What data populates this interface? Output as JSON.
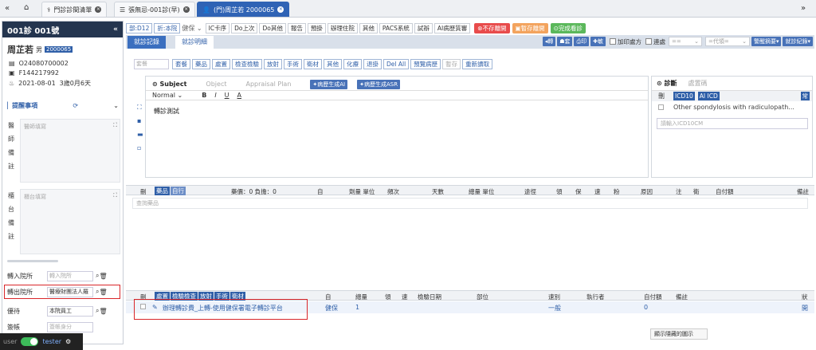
{
  "topbar": {
    "tabs": [
      {
        "label": "門診診間清單",
        "icon": "stethoscope-icon",
        "active": false
      },
      {
        "label": "張無忌-001診(早)",
        "icon": "list-icon",
        "active": false
      },
      {
        "label": "(門)周芷若 2000065",
        "icon": "user-icon",
        "active": true
      }
    ]
  },
  "patient": {
    "clinic": "001診 001號",
    "name": "周芷若",
    "sex": "男",
    "id_badge": "2000065",
    "record_no": "O24080700002",
    "national_id": "F144217992",
    "birth": "2021-08-01",
    "age": "3歲0月6天"
  },
  "left_panel": {
    "reminder_label": "提醒事項",
    "doctor_note_label": "醫師備註",
    "doctor_note_ph": "醫師填寫",
    "counter_note_label": "櫃台備註",
    "counter_note_ph": "櫃台填寫",
    "transfer_in_label": "轉入院所",
    "transfer_in_ph": "轉入院所",
    "transfer_out_label": "轉出院所",
    "transfer_out_value": "醫療財團法人羅",
    "discount_label": "優待",
    "discount_value": "本院員工",
    "copay_label": "簽帳",
    "copay_ph": "簽帳身分"
  },
  "user_footer": {
    "role": "user",
    "name": "tester"
  },
  "toolbar": {
    "dept": "部:D12",
    "discount": "折:本院",
    "insurance": "健保",
    "buttons": [
      "IC卡序",
      "Do上次",
      "Do其他",
      "報告",
      "預掛",
      "辦理住院",
      "其他",
      "PACS系統",
      "試辦",
      "AI病歷質審"
    ],
    "unsave_close": "不存離開",
    "temp_close": "暫存離開",
    "finish": "完成看診",
    "unsave_color": "#e84b4b",
    "temp_color": "#f3a35d",
    "finish_color": "#5bb85b"
  },
  "subtabs": {
    "record": "就診記錄",
    "detail": "就診明細",
    "right_buttons": [
      "轉",
      "套",
      "印",
      "敏"
    ],
    "add_prescription": "加印處方",
    "continuous": "連處",
    "select1": "==",
    "select2": "=代領=",
    "alert_btn": "警醒摘要",
    "visit_record_btn": "就診紀錄"
  },
  "order_buttons": {
    "search_ph": "套餐",
    "items": [
      "套餐",
      "藥品",
      "處置",
      "檢查檢驗",
      "放射",
      "手術",
      "衛材",
      "其他",
      "化療",
      "退掛",
      "Del All",
      "預覽病歷",
      "暫存",
      "重新讀取"
    ]
  },
  "soap": {
    "tabs": [
      "Subject",
      "Object",
      "Appraisal Plan"
    ],
    "ai_gen": "病歷生成AI",
    "ai_asr": "病歷生成ASR",
    "font_select": "Normal",
    "format": [
      "B",
      "I",
      "U",
      "A"
    ],
    "content": "轉診測試"
  },
  "diagnosis": {
    "tab1": "診斷",
    "tab2": "處置碼",
    "col_del": "刪",
    "icd10": "ICD10",
    "ai_icd": "AI ICD",
    "common": "常",
    "row1": "Other spondylosis with radiculopath...",
    "input_ph": "請輸入ICD10CM"
  },
  "drug_grid": {
    "col_del": "刪",
    "tag1": "藥品",
    "tag2": "自行",
    "summary": "藥價：0 負擔：0",
    "cols": [
      "自",
      "劑量 單位",
      "頻次",
      "天數",
      "總量 單位",
      "途徑",
      "領",
      "保",
      "速",
      "粉",
      "原因",
      "注",
      "衛",
      "自付額",
      "備註"
    ],
    "search_ph": "查詢藥品"
  },
  "proc_grid": {
    "col_del": "刪",
    "tags": [
      "處置",
      "檢驗檢查",
      "放射",
      "手術",
      "衛材"
    ],
    "cols": [
      "自",
      "總量",
      "領",
      "速",
      "檢驗日期",
      "部位",
      "速別",
      "執行者",
      "自付額",
      "備註",
      "狀"
    ],
    "row": {
      "name": "辦理轉診費_上轉-使用健保署電子轉診平台",
      "self": "健保",
      "qty": "1",
      "speed": "一般",
      "copay": "0",
      "status": "開"
    }
  },
  "tooltip": "顯示隱藏的圖示"
}
